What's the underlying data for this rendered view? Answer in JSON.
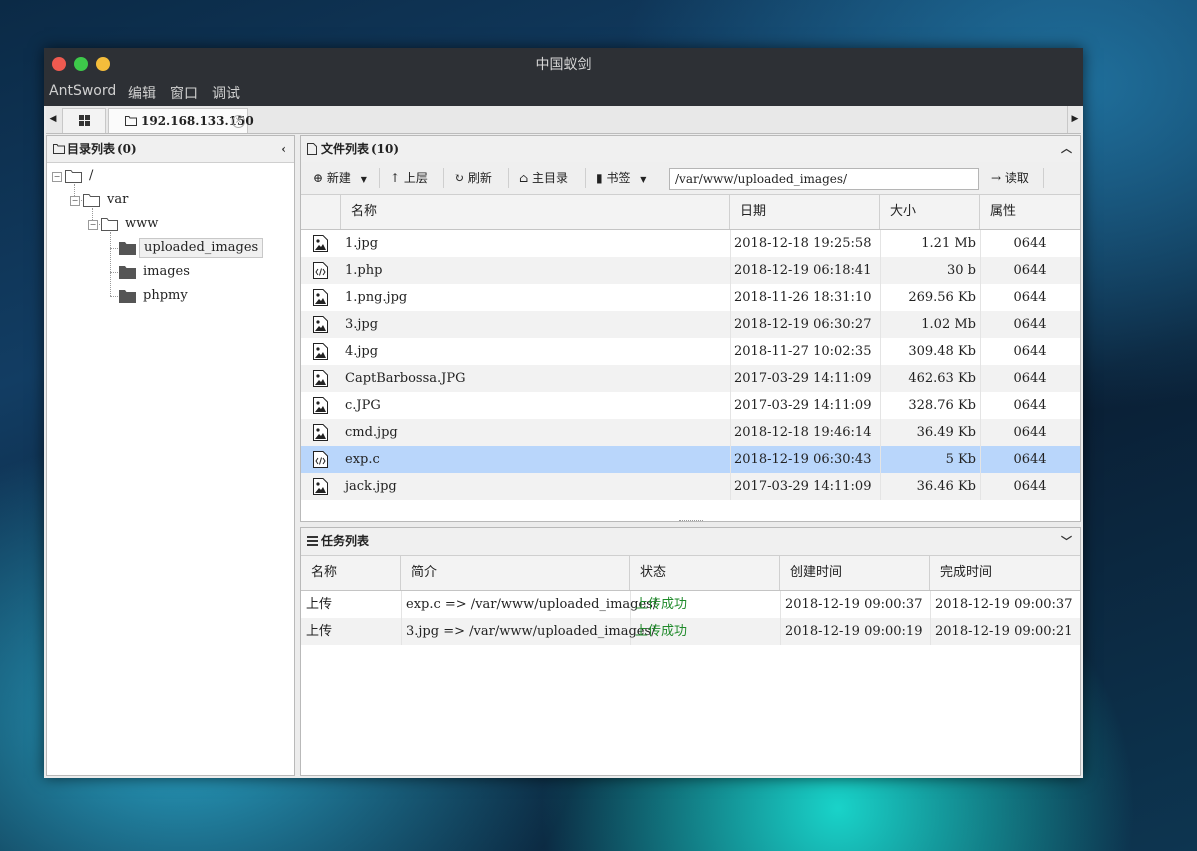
{
  "window": {
    "title": "中国蚁剑",
    "controls": {
      "close": "#ee5a50",
      "minimize": "#3dc94a",
      "maximize": "#f4bd3b"
    }
  },
  "menu": [
    "AntSword",
    "编辑",
    "窗口",
    "调试"
  ],
  "tabs": {
    "grid_icon": "grid-icon",
    "active_label": "192.168.133.150"
  },
  "tree": {
    "title": "目录列表",
    "count": "(0)",
    "nodes": [
      {
        "label": "/",
        "level": 0,
        "expanded": true
      },
      {
        "label": "var",
        "level": 1,
        "expanded": true
      },
      {
        "label": "www",
        "level": 2,
        "expanded": true
      },
      {
        "label": "uploaded_images",
        "level": 3,
        "selected": true
      },
      {
        "label": "images",
        "level": 3
      },
      {
        "label": "phpmy",
        "level": 3
      }
    ]
  },
  "files": {
    "title": "文件列表",
    "count": "(10)",
    "toolbar": {
      "new_label": "新建",
      "up_label": "上层",
      "refresh_label": "刷新",
      "home_label": "主目录",
      "bookmark_label": "书签",
      "path_value": "/var/www/uploaded_images/",
      "read_label": "读取"
    },
    "columns": [
      "名称",
      "日期",
      "大小",
      "属性"
    ],
    "rows": [
      {
        "icon": "image-file-icon",
        "name": "1.jpg",
        "date": "2018-12-18 19:25:58",
        "size": "1.21 Mb",
        "attr": "0644"
      },
      {
        "icon": "code-file-icon",
        "name": "1.php",
        "date": "2018-12-19 06:18:41",
        "size": "30 b",
        "attr": "0644"
      },
      {
        "icon": "image-file-icon",
        "name": "1.png.jpg",
        "date": "2018-11-26 18:31:10",
        "size": "269.56 Kb",
        "attr": "0644"
      },
      {
        "icon": "image-file-icon",
        "name": "3.jpg",
        "date": "2018-12-19 06:30:27",
        "size": "1.02 Mb",
        "attr": "0644"
      },
      {
        "icon": "image-file-icon",
        "name": "4.jpg",
        "date": "2018-11-27 10:02:35",
        "size": "309.48 Kb",
        "attr": "0644"
      },
      {
        "icon": "image-file-icon",
        "name": "CaptBarbossa.JPG",
        "date": "2017-03-29 14:11:09",
        "size": "462.63 Kb",
        "attr": "0644"
      },
      {
        "icon": "image-file-icon",
        "name": "c.JPG",
        "date": "2017-03-29 14:11:09",
        "size": "328.76 Kb",
        "attr": "0644"
      },
      {
        "icon": "image-file-icon",
        "name": "cmd.jpg",
        "date": "2018-12-18 19:46:14",
        "size": "36.49 Kb",
        "attr": "0644"
      },
      {
        "icon": "code-file-icon",
        "name": "exp.c",
        "date": "2018-12-19 06:30:43",
        "size": "5 Kb",
        "attr": "0644",
        "selected": true
      },
      {
        "icon": "image-file-icon",
        "name": "jack.jpg",
        "date": "2017-03-29 14:11:09",
        "size": "36.46 Kb",
        "attr": "0644"
      }
    ]
  },
  "tasks": {
    "title": "任务列表",
    "columns": [
      "名称",
      "简介",
      "状态",
      "创建时间",
      "完成时间"
    ],
    "rows": [
      {
        "name": "上传",
        "desc": "exp.c => /var/www/uploaded_images/",
        "status": "上传成功",
        "created": "2018-12-19 09:00:37",
        "finished": "2018-12-19 09:00:37"
      },
      {
        "name": "上传",
        "desc": "3.jpg => /var/www/uploaded_images/",
        "status": "上传成功",
        "created": "2018-12-19 09:00:19",
        "finished": "2018-12-19 09:00:21"
      }
    ]
  }
}
